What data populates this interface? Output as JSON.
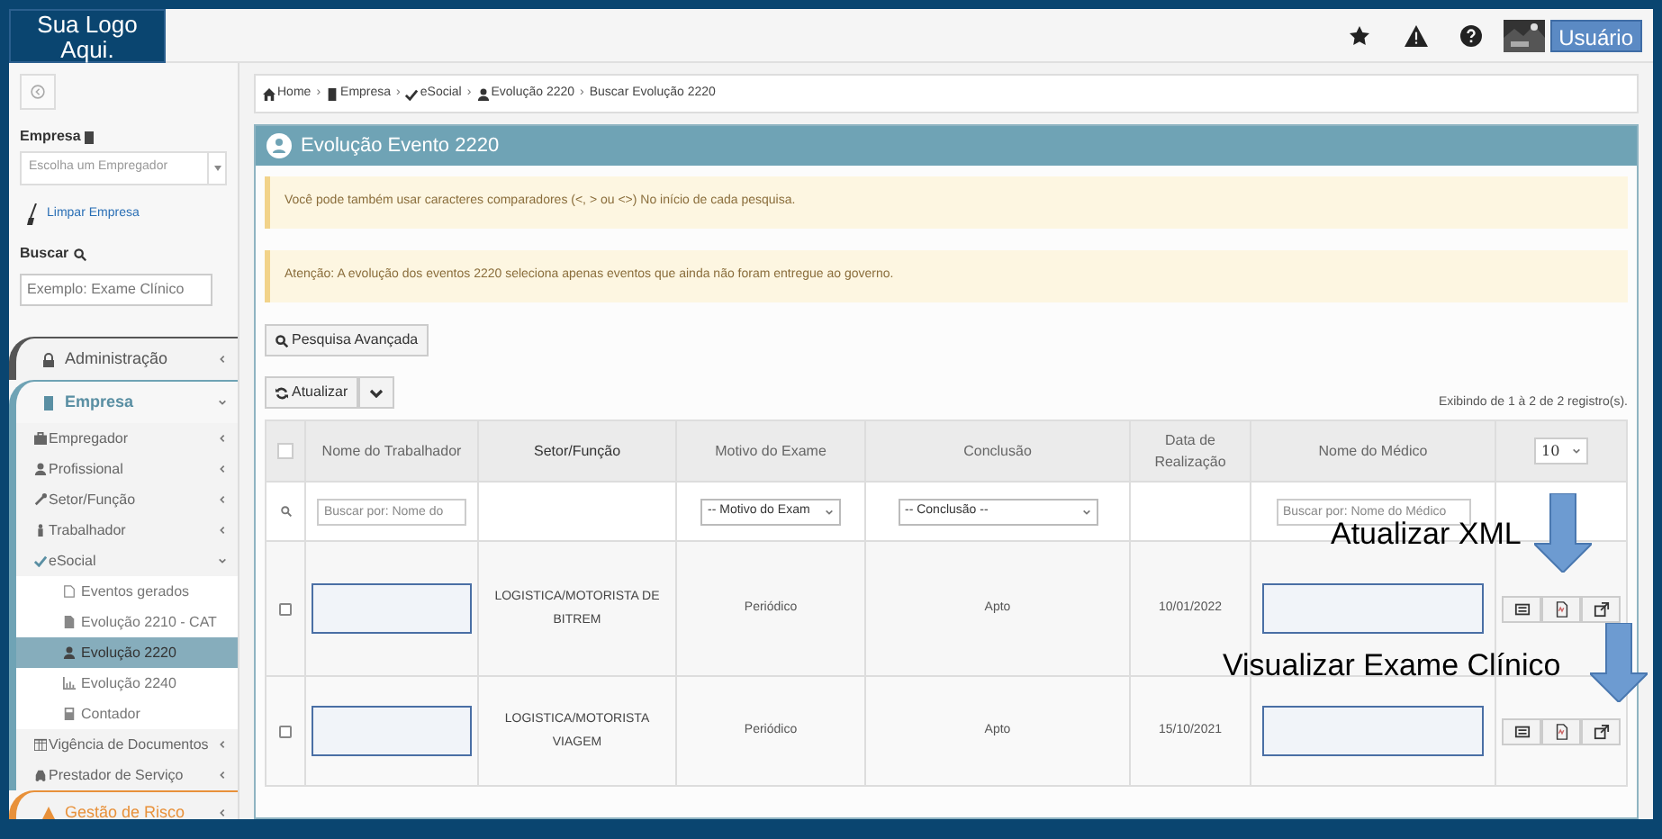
{
  "logo": {
    "text": "Sua Logo Aqui."
  },
  "topbar": {
    "user_button": "Usuário"
  },
  "sidebar": {
    "empresa_label": "Empresa",
    "empresa_select": {
      "placeholder": "Escolha um Empregador"
    },
    "clear_link": "Limpar Empresa",
    "search_label": "Buscar",
    "search": {
      "placeholder": "Exemplo: Exame Clínico"
    },
    "menu": [
      {
        "label": "Administração",
        "expanded": false
      },
      {
        "label": "Empresa",
        "expanded": true,
        "children": [
          {
            "label": "Empregador",
            "expanded": false
          },
          {
            "label": "Profissional",
            "expanded": false
          },
          {
            "label": "Setor/Função",
            "expanded": false
          },
          {
            "label": "Trabalhador",
            "expanded": false
          },
          {
            "label": "eSocial",
            "expanded": true,
            "children": [
              {
                "label": "Eventos gerados",
                "selected": false
              },
              {
                "label": "Evolução 2210 - CAT",
                "selected": false
              },
              {
                "label": "Evolução 2220",
                "selected": true
              },
              {
                "label": "Evolução 2240",
                "selected": false
              },
              {
                "label": "Contador",
                "selected": false
              }
            ]
          },
          {
            "label": "Vigência de Documentos",
            "expanded": false
          },
          {
            "label": "Prestador de Serviço",
            "expanded": false
          }
        ]
      },
      {
        "label": "Gestão de Risco",
        "expanded": false
      }
    ]
  },
  "breadcrumb": [
    {
      "label": "Home"
    },
    {
      "separator": "›",
      "label": "Empresa"
    },
    {
      "separator": "›",
      "label": "eSocial"
    },
    {
      "separator": "›",
      "label": "Evolução 2220"
    },
    {
      "separator": "›",
      "label": "Buscar Evolução 2220"
    }
  ],
  "panel": {
    "title": "Evolução Evento 2220",
    "alerts": [
      "Você pode também usar caracteres comparadores (<, > ou <>) No início de cada pesquisa.",
      "Atenção: A evolução dos eventos 2220 seleciona apenas eventos que ainda não foram entregue ao governo."
    ],
    "advanced_search_button": "Pesquisa Avançada",
    "refresh_button": "Atualizar",
    "records_info": "Exibindo de 1 à 2 de 2 registro(s).",
    "table": {
      "columns": [
        "Nome do Trabalhador",
        "Setor/Função",
        "Motivo do Exame",
        "Conclusão",
        "Data de Realização",
        "Nome do Médico"
      ],
      "select_all_checked": false,
      "page_size": "10",
      "filters": {
        "name": {
          "placeholder": "Buscar por: Nome do "
        },
        "motivo": "-- Motivo do Exam",
        "conclusao": "-- Conclusão --",
        "medico": {
          "placeholder": "Buscar por: Nome do Médico"
        }
      },
      "rows": [
        {
          "checked": false,
          "setor": "LOGISTICA/MOTORISTA DE BITREM",
          "motivo": "Periódico",
          "conclusao": "Apto",
          "data": "10/01/2022"
        },
        {
          "checked": false,
          "setor": "LOGISTICA/MOTORISTA VIAGEM",
          "motivo": "Periódico",
          "conclusao": "Apto",
          "data": "15/10/2021"
        }
      ]
    }
  },
  "annotations": [
    "Atualizar XML",
    "Visualizar Exame Clínico"
  ]
}
